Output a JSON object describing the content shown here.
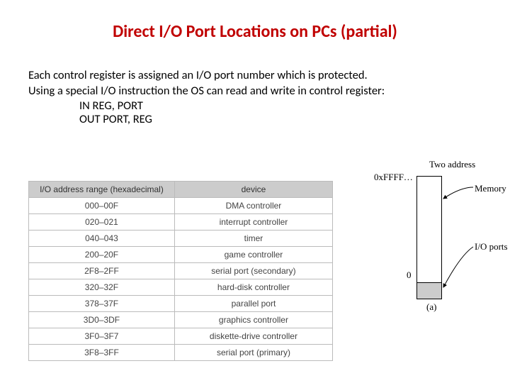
{
  "title": "Direct I/O Port Locations on PCs (partial)",
  "paragraph1": "Each control register is assigned an I/O port number which is protected.",
  "paragraph2": "Using a special I/O instruction the OS can read and write in control register:",
  "instruction1": "  IN REG, PORT",
  "instruction2": "OUT PORT, REG",
  "table": {
    "headers": [
      "I/O address range (hexadecimal)",
      "device"
    ],
    "rows": [
      [
        "000–00F",
        "DMA controller"
      ],
      [
        "020–021",
        "interrupt controller"
      ],
      [
        "040–043",
        "timer"
      ],
      [
        "200–20F",
        "game controller"
      ],
      [
        "2F8–2FF",
        "serial port (secondary)"
      ],
      [
        "320–32F",
        "hard-disk controller"
      ],
      [
        "378–37F",
        "parallel port"
      ],
      [
        "3D0–3DF",
        "graphics controller"
      ],
      [
        "3F0–3F7",
        "diskette-drive controller"
      ],
      [
        "3F8–3FF",
        "serial port (primary)"
      ]
    ]
  },
  "diagram": {
    "heading": "Two address",
    "top_label": "0xFFFF…",
    "zero_label": "0",
    "memory_label": "Memory",
    "io_label": "I/O ports",
    "sub_label": "(a)"
  }
}
